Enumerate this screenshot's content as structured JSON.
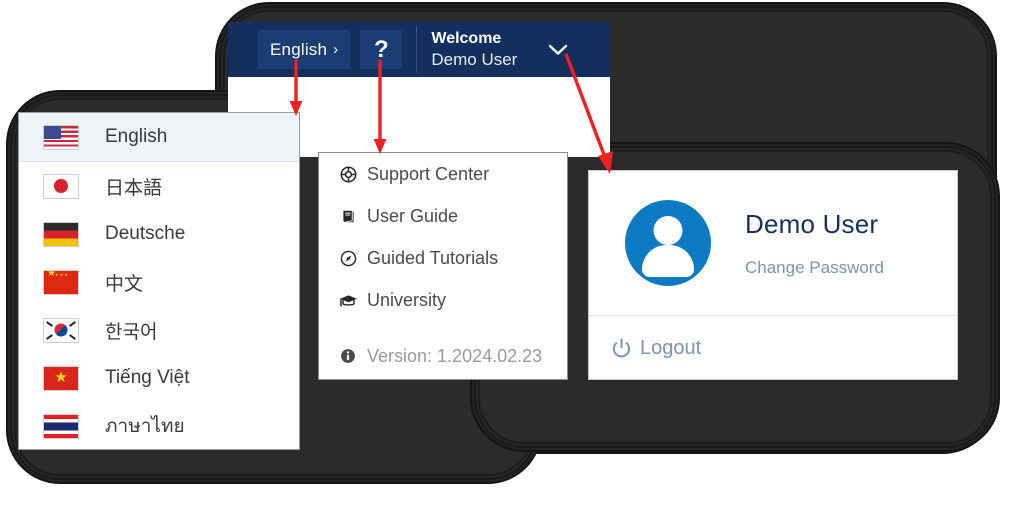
{
  "topbar": {
    "language_button": {
      "label": "English",
      "chevron": "›",
      "icon_name": "chevron-right-icon"
    },
    "help_button": {
      "label": "?",
      "icon_name": "question-mark-icon"
    },
    "welcome_label": "Welcome",
    "user_name": "Demo User",
    "chevron": "⌄",
    "colors": {
      "bar": "#122f5e",
      "button": "#1b3d73"
    }
  },
  "language_menu": {
    "items": [
      {
        "label": "English",
        "flag": "flag-us",
        "flag_name": "flag-united-states",
        "selected": true
      },
      {
        "label": "日本語",
        "flag": "flag-jp",
        "flag_name": "flag-japan",
        "selected": false
      },
      {
        "label": "Deutsche",
        "flag": "flag-de",
        "flag_name": "flag-germany",
        "selected": false
      },
      {
        "label": "中文",
        "flag": "flag-cn",
        "flag_name": "flag-china",
        "selected": false
      },
      {
        "label": "한국어",
        "flag": "flag-kr",
        "flag_name": "flag-south-korea",
        "selected": false
      },
      {
        "label": "Tiếng Việt",
        "flag": "flag-vn",
        "flag_name": "flag-vietnam",
        "selected": false
      },
      {
        "label": "ภาษาไทย",
        "flag": "flag-th",
        "flag_name": "flag-thailand",
        "selected": false
      }
    ]
  },
  "help_menu": {
    "items": [
      {
        "label": "Support Center",
        "icon_name": "lifebuoy-icon"
      },
      {
        "label": "User Guide",
        "icon_name": "book-icon"
      },
      {
        "label": "Guided Tutorials",
        "icon_name": "compass-icon"
      },
      {
        "label": "University",
        "icon_name": "graduation-cap-icon"
      }
    ],
    "version_label": "Version: 1.2024.02.23",
    "version_icon_name": "info-icon"
  },
  "user_menu": {
    "user_name": "Demo User",
    "change_password_label": "Change Password",
    "logout_label": "Logout",
    "avatar_icon_name": "user-avatar-icon",
    "logout_icon_name": "power-icon",
    "avatar_color": "#0d7ac4",
    "name_color": "#15315f",
    "link_color": "#7e93ad"
  },
  "annotations": {
    "arrow_color": "#ed2024",
    "arrows": [
      {
        "name": "arrow-to-language-menu"
      },
      {
        "name": "arrow-to-help-menu"
      },
      {
        "name": "arrow-to-user-menu"
      }
    ]
  }
}
